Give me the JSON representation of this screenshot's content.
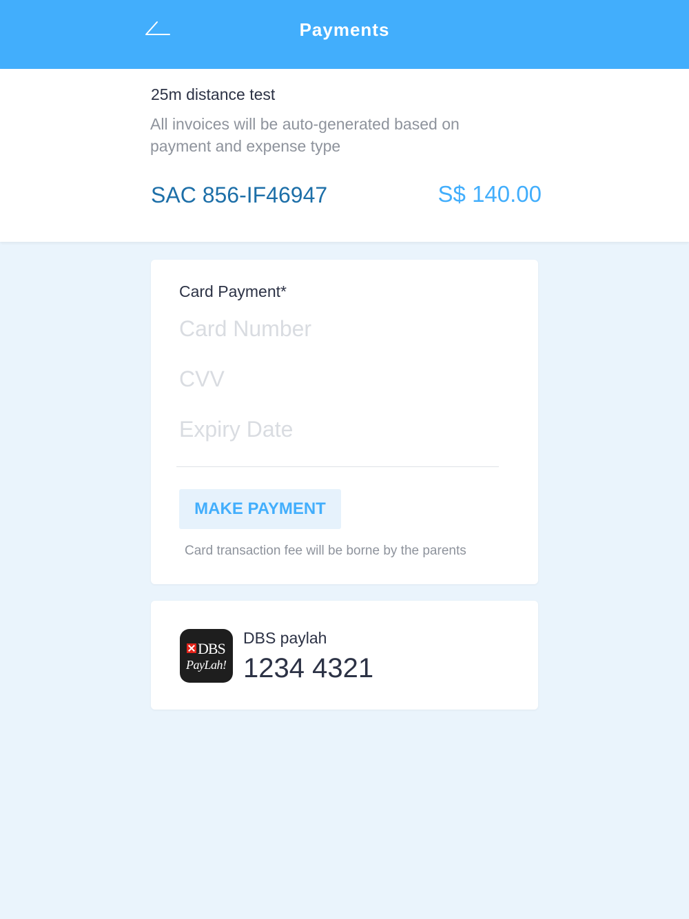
{
  "header": {
    "title": "Payments",
    "back_icon": "back-arrow-icon"
  },
  "summary": {
    "event_title": "25m distance test",
    "description": "All invoices will be auto-generated based on payment and expense type",
    "invoice_ref": "SAC 856-IF46947",
    "amount": "S$ 140.00"
  },
  "card_payment": {
    "title": "Card Payment*",
    "card_number_placeholder": "Card Number",
    "cvv_placeholder": "CVV",
    "expiry_placeholder": "Expiry Date",
    "button_label": "MAKE PAYMENT",
    "fee_note": "Card transaction fee will be borne by the parents"
  },
  "paylah": {
    "logo_text_brand": "DBS",
    "logo_text_product": "PayLah!",
    "label": "DBS paylah",
    "number": "1234 4321"
  },
  "colors": {
    "header": "#42aefc",
    "page_background": "#eaf4fc",
    "invoice_ref": "#1d6fa8",
    "amount": "#42aefc",
    "button_background": "#e6f2fc",
    "logo_red": "#e2231a"
  }
}
